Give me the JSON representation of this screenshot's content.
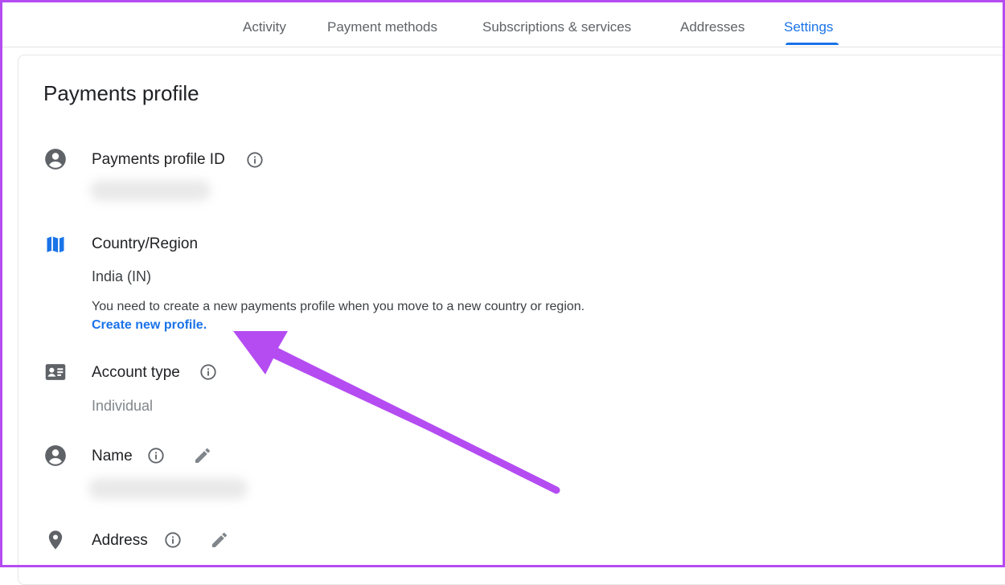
{
  "tabs": [
    {
      "label": "Activity",
      "active": false
    },
    {
      "label": "Payment methods",
      "active": false
    },
    {
      "label": "Subscriptions & services",
      "active": false
    },
    {
      "label": "Addresses",
      "active": false
    },
    {
      "label": "Settings",
      "active": true
    }
  ],
  "section": {
    "title": "Payments profile",
    "profile_id": {
      "label": "Payments profile ID",
      "icon": "account-circle-icon"
    },
    "country": {
      "label": "Country/Region",
      "icon": "map-icon",
      "value": "India (IN)",
      "note": "You need to create a new payments profile when you move to a new country or region.",
      "link": "Create new profile."
    },
    "account_type": {
      "label": "Account type",
      "icon": "badge-icon",
      "value": "Individual"
    },
    "name": {
      "label": "Name",
      "icon": "account-circle-icon"
    },
    "address": {
      "label": "Address",
      "icon": "location-pin-icon"
    }
  },
  "colors": {
    "accent": "#1a73e8",
    "annotation": "#b44cf2"
  }
}
